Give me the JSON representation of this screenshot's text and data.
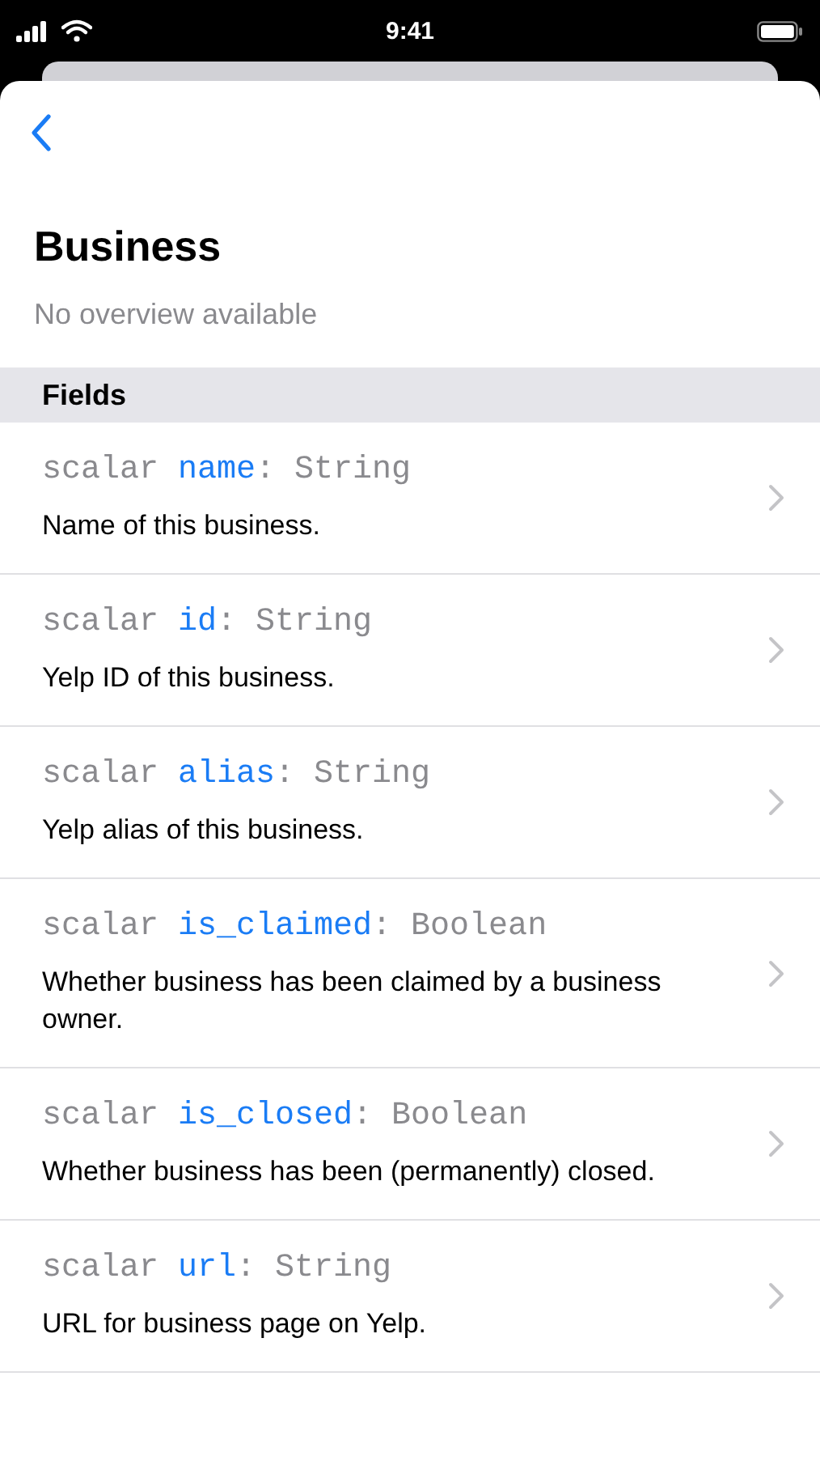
{
  "status_bar": {
    "time": "9:41"
  },
  "header": {
    "title": "Business",
    "subtitle": "No overview available"
  },
  "section": {
    "title": "Fields"
  },
  "fields": [
    {
      "keyword": "scalar ",
      "name": "name",
      "type": ": String",
      "description": "Name of this business."
    },
    {
      "keyword": "scalar ",
      "name": "id",
      "type": ": String",
      "description": "Yelp ID of this business."
    },
    {
      "keyword": "scalar ",
      "name": "alias",
      "type": ": String",
      "description": "Yelp alias of this business."
    },
    {
      "keyword": "scalar ",
      "name": "is_claimed",
      "type": ": Boolean",
      "description": "Whether business has been claimed by a business owner."
    },
    {
      "keyword": "scalar ",
      "name": "is_closed",
      "type": ": Boolean",
      "description": "Whether business has been (permanently) closed."
    },
    {
      "keyword": "scalar ",
      "name": "url",
      "type": ": String",
      "description": "URL for business page on Yelp."
    }
  ]
}
